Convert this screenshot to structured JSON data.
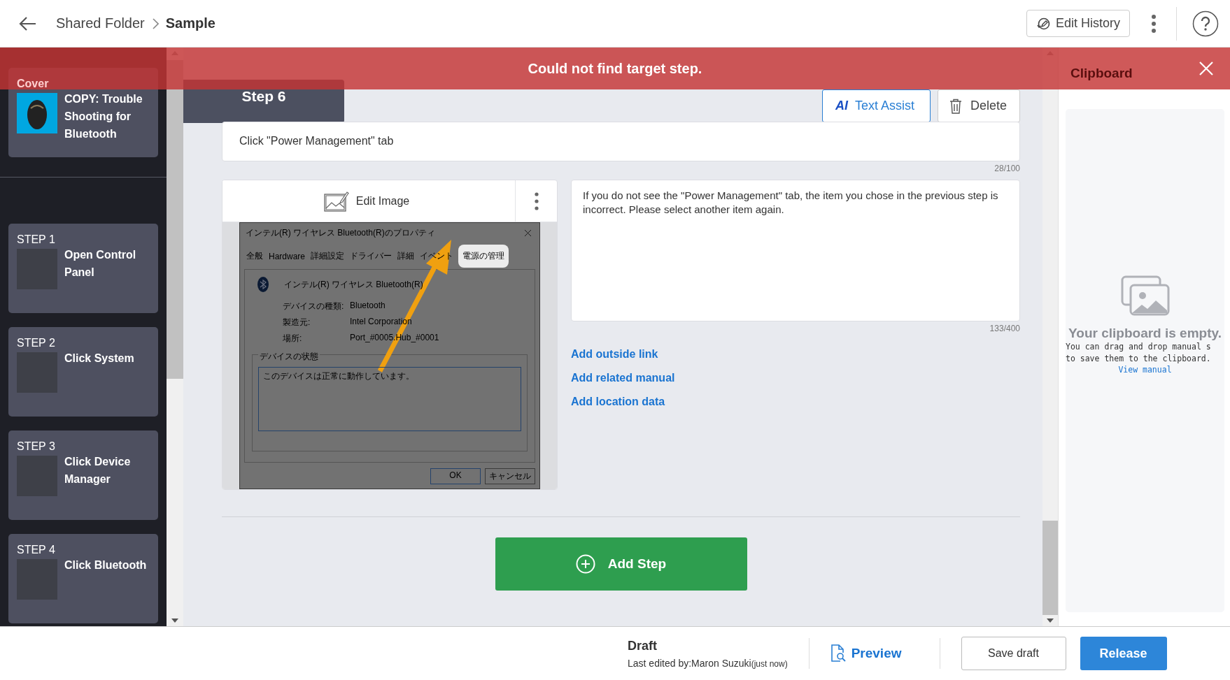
{
  "header": {
    "breadcrumb": [
      {
        "label": "Shared Folder"
      },
      {
        "label": "Sample"
      }
    ],
    "edit_history": "Edit History"
  },
  "alert": {
    "message": "Could not find target step."
  },
  "sidebar": {
    "cover": {
      "label": "Cover",
      "title": "COPY: Trouble Shooting for Bluetooth"
    },
    "steps": [
      {
        "label": "STEP 1",
        "title": "Open Control Panel"
      },
      {
        "label": "STEP 2",
        "title": "Click System"
      },
      {
        "label": "STEP 3",
        "title": "Click Device Manager"
      },
      {
        "label": "STEP 4",
        "title": "Click Bluetooth"
      }
    ]
  },
  "step": {
    "tab": "Step 6",
    "ai_badge": "AI",
    "text_assist": "Text Assist",
    "delete": "Delete",
    "title_value": "Click \"Power Management\" tab",
    "title_count": "28/100",
    "edit_image": "Edit Image",
    "screenshot": {
      "title": "インテル(R) ワイヤレス Bluetooth(R)のプロパティ",
      "tabs": [
        {
          "label": "全般",
          "highlighted": false
        },
        {
          "label": "Hardware",
          "highlighted": false
        },
        {
          "label": "詳細設定",
          "highlighted": false
        },
        {
          "label": "ドライバー",
          "highlighted": false
        },
        {
          "label": "詳細",
          "highlighted": false
        },
        {
          "label": "イベント",
          "highlighted": false
        },
        {
          "label": "電源の管理",
          "highlighted": true
        }
      ],
      "device": "インテル(R) ワイヤレス Bluetooth(R)",
      "properties": [
        {
          "label": "デバイスの種類:",
          "value": "Bluetooth"
        },
        {
          "label": "製造元:",
          "value": "Intel Corporation"
        },
        {
          "label": "場所:",
          "value": "Port_#0005.Hub_#0001"
        }
      ],
      "group": "デバイスの状態",
      "status": "このデバイスは正常に動作しています。",
      "ok": "OK",
      "cancel": "キャンセル"
    },
    "description": "If you do not see the \"Power Management\" tab, the item you chose in the previous step is incorrect. Please select another item again.",
    "description_count": "133/400",
    "links": [
      "Add outside link",
      "Add related manual",
      "Add location data"
    ]
  },
  "add_step": "Add Step",
  "clipboard": {
    "title": "Clipboard",
    "empty_title": "Your clipboard is empty.",
    "hint_lines": [
      "You can drag and drop manual s",
      "to save them to the clipboard."
    ],
    "link": "View manual"
  },
  "footer": {
    "status": "Draft",
    "edited_by": "Last edited by:Maron Suzuki",
    "edited_time": "(just now)",
    "preview": "Preview",
    "save_draft": "Save draft",
    "release": "Release"
  }
}
